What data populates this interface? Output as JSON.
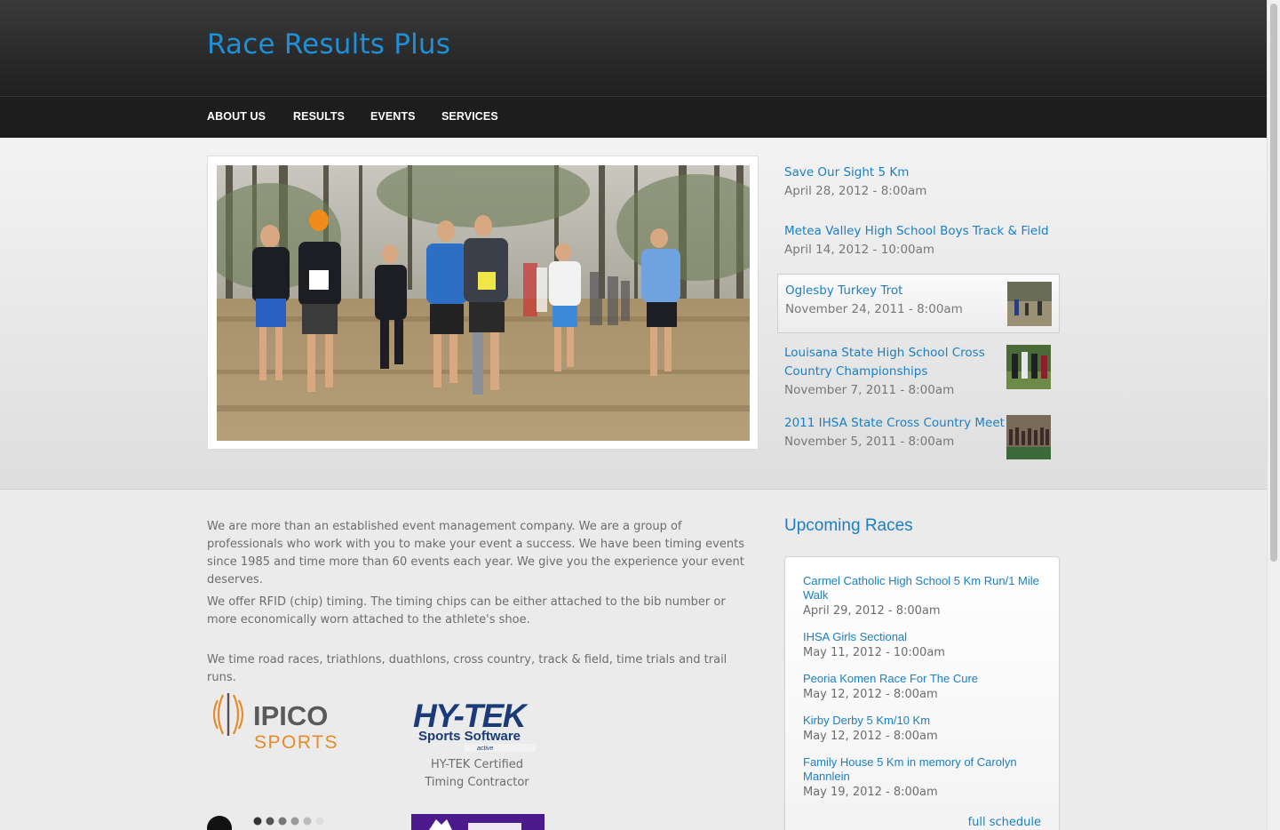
{
  "site": {
    "title": "Race Results Plus"
  },
  "nav": {
    "items": [
      "ABOUT US",
      "RESULTS",
      "EVENTS",
      "SERVICES"
    ]
  },
  "featured": [
    {
      "title": "Save Our Sight 5 Km",
      "date": "April 28, 2012 - 8:00am"
    },
    {
      "title": "Metea Valley High School Boys Track & Field",
      "date": "April 14, 2012 - 10:00am"
    },
    {
      "title": "Oglesby Turkey Trot",
      "date": "November 24, 2011 - 8:00am"
    },
    {
      "title": "Louisana State High School Cross Country Championships",
      "date": "November 7, 2011 - 8:00am"
    },
    {
      "title": "2011 IHSA State Cross Country Meet",
      "date": "November 5, 2011 - 8:00am"
    }
  ],
  "about": {
    "paragraphs": [
      "We are more than an established event management company. We are a group of professionals who work with you to make your event a success. We have been timing events since 1985 and time more than 60 events each year. We give you the experience your event deserves.",
      "We offer RFID (chip) timing. The timing chips can be either attached to the bib number or more economically worn attached to the athlete's shoe.",
      "We time road races, triathlons, duathlons, cross country, track & field, time trials and trail runs."
    ]
  },
  "logos": {
    "ipico_1": "IPICO",
    "ipico_2": "SPORTS",
    "hytek_1": "HY-TEK",
    "hytek_2": "Sports  Software",
    "hytek_caption_1": "HY-TEK Certified",
    "hytek_caption_2": "Timing Contractor"
  },
  "upcoming": {
    "heading": "Upcoming Races",
    "items": [
      {
        "title": "Carmel Catholic High School 5 Km Run/1 Mile Walk",
        "date": "April 29, 2012 - 8:00am"
      },
      {
        "title": "IHSA Girls Sectional",
        "date": "May 11, 2012 - 10:00am"
      },
      {
        "title": "Peoria Komen Race For The Cure",
        "date": "May 12, 2012 - 8:00am"
      },
      {
        "title": "Kirby Derby 5 Km/10 Km",
        "date": "May 12, 2012 - 8:00am"
      },
      {
        "title": "Family House 5 Km in memory of Carolyn Mannlein",
        "date": "May 19, 2012 - 8:00am"
      }
    ],
    "full_schedule": "full schedule"
  },
  "colors": {
    "accent": "#1a7fc4",
    "header": "#1f1f1f",
    "ipico_orange": "#e98a2a",
    "hytek_navy": "#1b3a78",
    "lynx_purple": "#4b1a8c"
  }
}
